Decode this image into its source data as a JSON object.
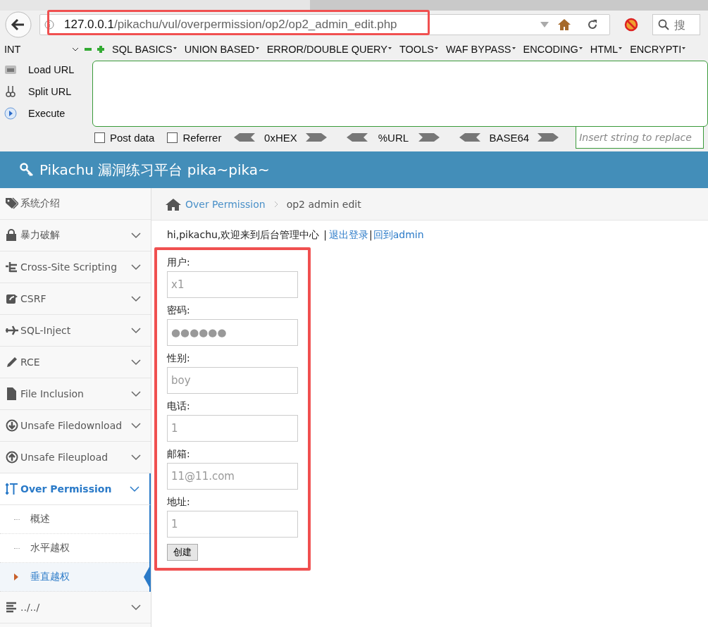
{
  "browser": {
    "url_host": "127.0.0.1",
    "url_path": "/pikachu/vul/overpermission/op2/op2_admin_edit.php",
    "search_placeholder": "搜"
  },
  "hackbar": {
    "select": "INT",
    "menus": [
      "SQL BASICS",
      "UNION BASED",
      "ERROR/DOUBLE QUERY",
      "TOOLS",
      "WAF BYPASS",
      "ENCODING",
      "HTML",
      "ENCRYPTI"
    ],
    "actions": [
      "Load URL",
      "Split URL",
      "Execute"
    ],
    "checks": [
      {
        "label": "Post data",
        "checked": false
      },
      {
        "label": "Referrer",
        "checked": false
      }
    ],
    "encoders": [
      "0xHEX",
      "%URL",
      "BASE64"
    ],
    "replace_placeholder": "Insert string to replace"
  },
  "header": {
    "title": "Pikachu 漏洞练习平台 pika~pika~"
  },
  "sidebar": {
    "items": [
      {
        "label": "系统介绍",
        "kind": "link",
        "selected": false
      },
      {
        "label": "暴力破解",
        "kind": "menu",
        "selected": false,
        "expanded": false
      },
      {
        "label": "Cross-Site Scripting",
        "kind": "menu",
        "selected": false,
        "expanded": false
      },
      {
        "label": "CSRF",
        "kind": "menu",
        "selected": false,
        "expanded": false
      },
      {
        "label": "SQL-Inject",
        "kind": "menu",
        "selected": false,
        "expanded": false
      },
      {
        "label": "RCE",
        "kind": "menu",
        "selected": false,
        "expanded": false
      },
      {
        "label": "File Inclusion",
        "kind": "menu",
        "selected": false,
        "expanded": false
      },
      {
        "label": "Unsafe Filedownload",
        "kind": "menu",
        "selected": false,
        "expanded": false
      },
      {
        "label": "Unsafe Fileupload",
        "kind": "menu",
        "selected": false,
        "expanded": false
      },
      {
        "label": "Over Permission",
        "kind": "menu",
        "selected": true,
        "expanded": true,
        "children": [
          {
            "label": "概述",
            "selected": false
          },
          {
            "label": "水平越权",
            "selected": false
          },
          {
            "label": "垂直越权",
            "selected": true
          }
        ]
      },
      {
        "label": "../../",
        "kind": "menu",
        "selected": false,
        "expanded": false
      }
    ]
  },
  "breadcrumb": {
    "link": "Over Permission",
    "current": "op2 admin edit"
  },
  "welcome": {
    "text": "hi,pikachu,欢迎来到后台管理中心",
    "separator_1": "|",
    "logout": "退出登录",
    "separator_2": "|",
    "admin_link": "回到admin"
  },
  "form": {
    "fields": [
      {
        "label": "用户:",
        "value": "x1"
      },
      {
        "label": "密码:",
        "value": "●●●●●●"
      },
      {
        "label": "性别:",
        "value": "boy"
      },
      {
        "label": "电话:",
        "value": "1"
      },
      {
        "label": "邮箱:",
        "value": "11@11.com"
      },
      {
        "label": "地址:",
        "value": "1"
      }
    ],
    "submit": "创建"
  }
}
